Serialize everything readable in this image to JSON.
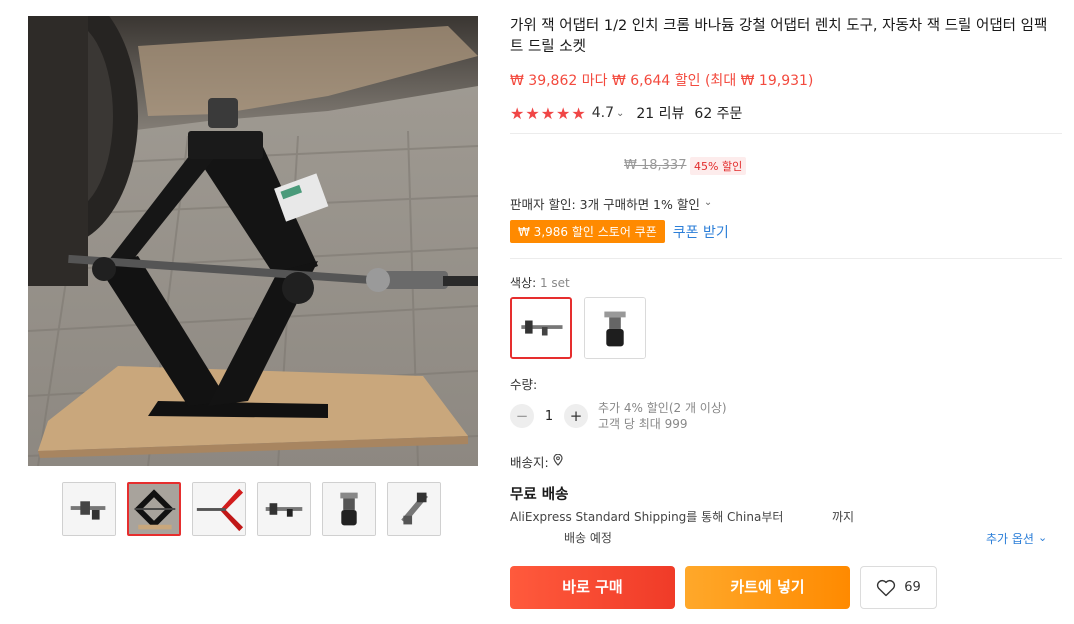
{
  "product": {
    "title": "가위 잭 어댑터 1/2 인치 크롬 바나듐 강철 어댑터 렌치 도구, 자동차 잭 드릴 어댑터 임팩트 드릴 소켓",
    "price_line": "₩ 39,862 마다 ₩ 6,644 할인 (최대 ₩ 19,931)",
    "rating": "4.7",
    "reviews": "21 리뷰",
    "orders": "62 주문",
    "original_price": "₩ 18,337",
    "discount_badge": "45% 할인",
    "seller_discount": "판매자 할인: 3개 구매하면 1% 할인",
    "coupon_tag": "₩ 3,986 할인 스토어 쿠폰",
    "coupon_get": "쿠폰 받기"
  },
  "gallery": {
    "thumbnail_count": 6,
    "selected_index": 1
  },
  "color": {
    "label": "색상: ",
    "value": "1 set",
    "selected_index": 0
  },
  "quantity": {
    "label": "수량:",
    "value": "1",
    "minus": "−",
    "plus": "+",
    "note_line1": "추가 4% 할인(2 개 이상)",
    "note_line2": "고객 당 최대 999"
  },
  "shipping": {
    "ship_to_label": "배송지:",
    "free_shipping": "무료 배송",
    "method": "AliExpress Standard Shipping를 통해 China부터",
    "until": "까지",
    "eta": "배송 예정",
    "more_options": "추가 옵션"
  },
  "actions": {
    "buy_now": "바로 구매",
    "add_to_cart": "카트에 넣기",
    "wishlist_count": "69"
  },
  "colors": {
    "price_red": "#f34a3e",
    "star_red": "#f04646",
    "buy_now": "#f03b28",
    "add_to_cart": "#ff8a00",
    "link_blue": "#2d7fd8",
    "coupon_orange": "#ff8a00"
  }
}
